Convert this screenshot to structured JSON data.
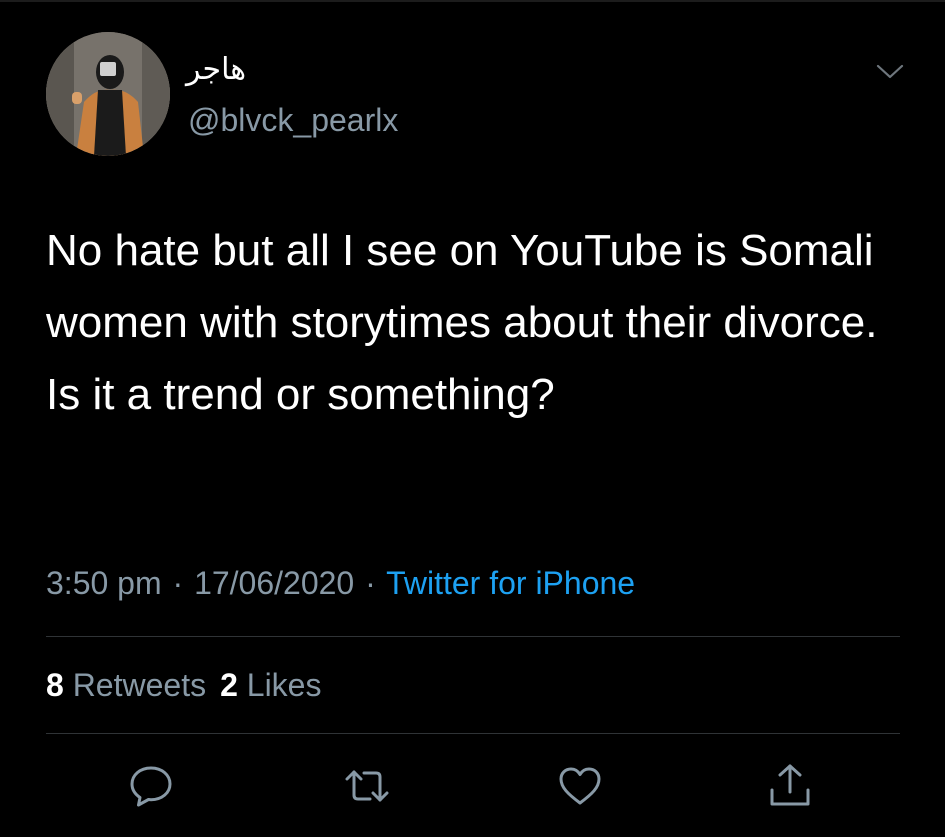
{
  "user": {
    "display_name": "هاجر",
    "handle": "@blvck_pearlx"
  },
  "tweet": {
    "text": "No hate but all I see on YouTube is Somali women with storytimes about their divorce. Is it a trend or something?"
  },
  "meta": {
    "time": "3:50 pm",
    "separator": "·",
    "date": "17/06/2020",
    "source": "Twitter for iPhone"
  },
  "stats": {
    "retweets_count": "8",
    "retweets_label": "Retweets",
    "likes_count": "2",
    "likes_label": "Likes"
  },
  "icons": {
    "caret": "chevron-down-icon",
    "reply": "reply-icon",
    "retweet": "retweet-icon",
    "like": "heart-icon",
    "share": "share-icon"
  },
  "colors": {
    "background": "#000000",
    "primary_text": "#ffffff",
    "secondary_text": "#8899a6",
    "link": "#1da1f2",
    "divider": "#2f3336"
  }
}
